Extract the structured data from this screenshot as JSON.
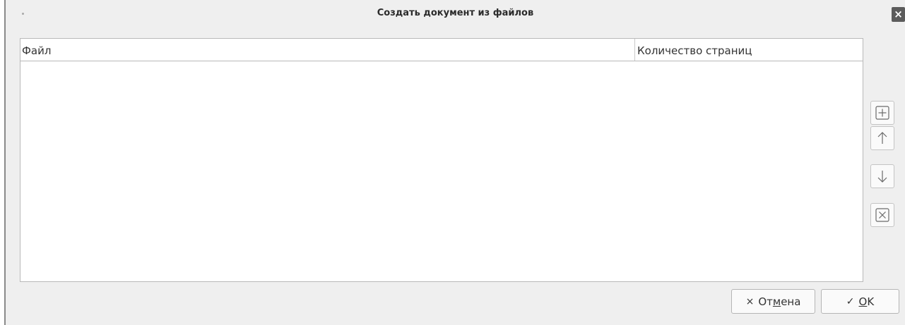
{
  "window": {
    "title": "Создать документ из файлов",
    "close_glyph": "×"
  },
  "table": {
    "columns": [
      "Файл",
      "Количество страниц"
    ],
    "rows": []
  },
  "side_buttons": {
    "add_icon": "plus-in-box-icon",
    "up_icon": "arrow-up-icon",
    "down_icon": "arrow-down-icon",
    "remove_icon": "x-in-box-icon"
  },
  "footer": {
    "cancel": {
      "icon": "×",
      "pre": "От",
      "mnemonic": "м",
      "post": "ена"
    },
    "ok": {
      "icon": "✓",
      "pre": "",
      "mnemonic": "O",
      "post": "K"
    }
  },
  "colors": {
    "dialog_bg": "#efefef",
    "table_bg": "#ffffff",
    "border": "#b9b9b9",
    "close_bg": "#5c5c5c"
  }
}
